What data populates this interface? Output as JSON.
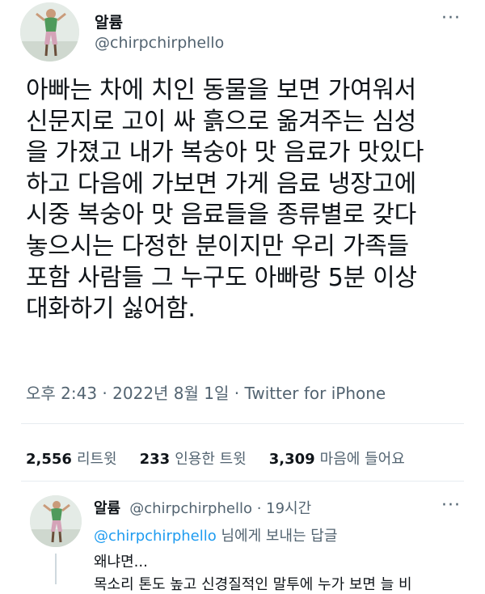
{
  "tweet": {
    "name": "알륨",
    "handle": "@chirpchirphello",
    "more": "···",
    "text": "아빠는 차에 치인 동물을 보면 가여워서\n신문지로 고이 싸 흙으로 옮겨주는 심성\n을 가졌고 내가 복숭아 맛 음료가 맛있다\n하고 다음에 가보면 가게 음료 냉장고에\n시중 복숭아 맛  음료들을 종류별로 갖다\n놓으시는 다정한 분이지만 우리 가족들\n포함 사람들 그 누구도 아빠랑 5분 이상\n대화하기 싫어함.",
    "meta": "오후 2:43 · 2022년 8월 1일 · Twitter for iPhone"
  },
  "stats": {
    "retweets_count": "2,556",
    "retweets_label": "리트윗",
    "quotes_count": "233",
    "quotes_label": "인용한 트윗",
    "likes_count": "3,309",
    "likes_label": "마음에 들어요"
  },
  "reply": {
    "name": "알륨",
    "handle_time": "@chirpchirphello · 19시간",
    "more": "···",
    "replying_to_handle": "@chirpchirphello",
    "replying_suffix": " 님에게 보내는 답글",
    "text_line1": "왜냐면...",
    "text_line2": "목소리 톤도 높고 신경질적인 말투에 누가 보면 늘 비"
  },
  "colors": {
    "link": "#1d9bf0",
    "secondary_text": "#536471",
    "primary_text": "#0f1419",
    "divider": "#e6ecf0"
  }
}
